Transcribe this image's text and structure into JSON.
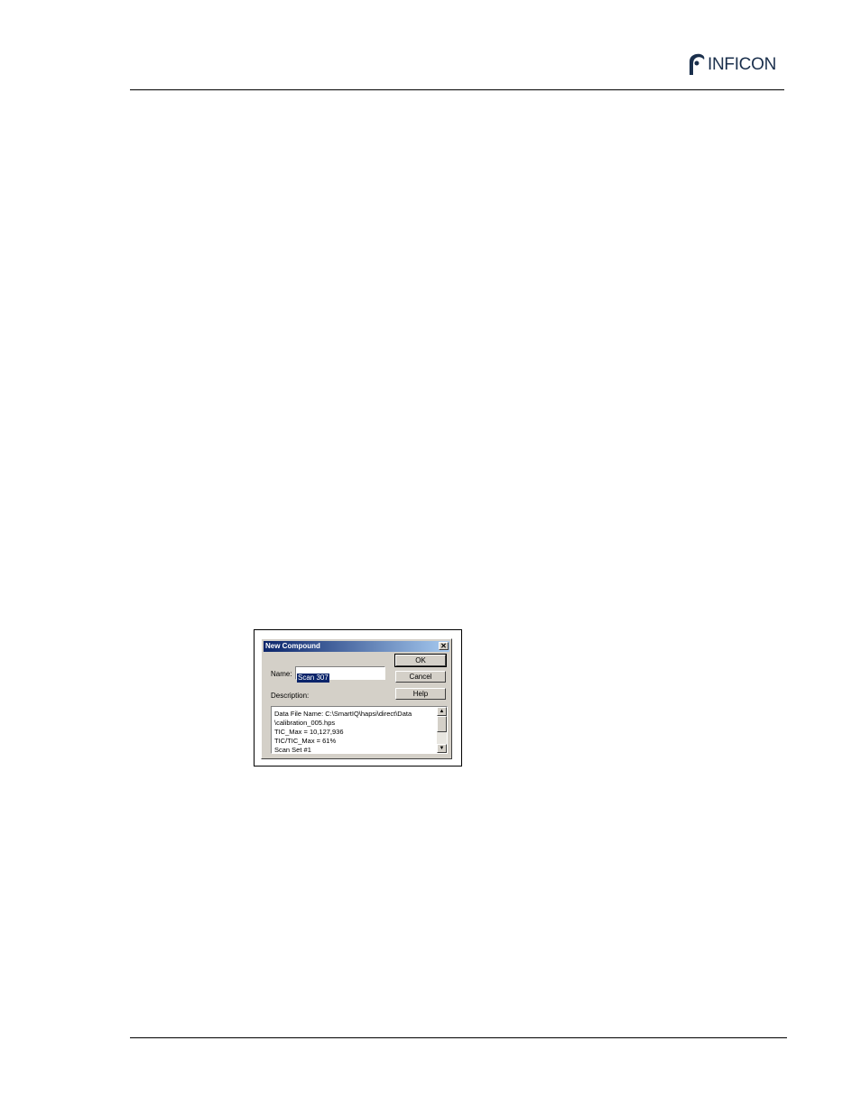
{
  "header": {
    "brand_text": "INFICON"
  },
  "dialog": {
    "title": "New Compound",
    "close_glyph": "✕",
    "buttons": {
      "ok": "OK",
      "cancel": "Cancel",
      "help": "Help"
    },
    "name_label": "Name:",
    "name_value": "Scan 307",
    "description_label": "Description:",
    "description_lines": [
      "Data File Name: C:\\SmartIQ\\hapsi\\direct\\Data",
      "\\calibration_005.hps",
      "TIC_Max = 10,127,936",
      "TIC/TIC_Max = 61%",
      "Scan Set #1"
    ],
    "scroll_up_glyph": "▲",
    "scroll_down_glyph": "▼"
  },
  "colors": {
    "brand": "#1a2f4c",
    "titlebar_start": "#0a246a",
    "titlebar_end": "#a6caf0",
    "dialog_face": "#d4d0c8"
  }
}
